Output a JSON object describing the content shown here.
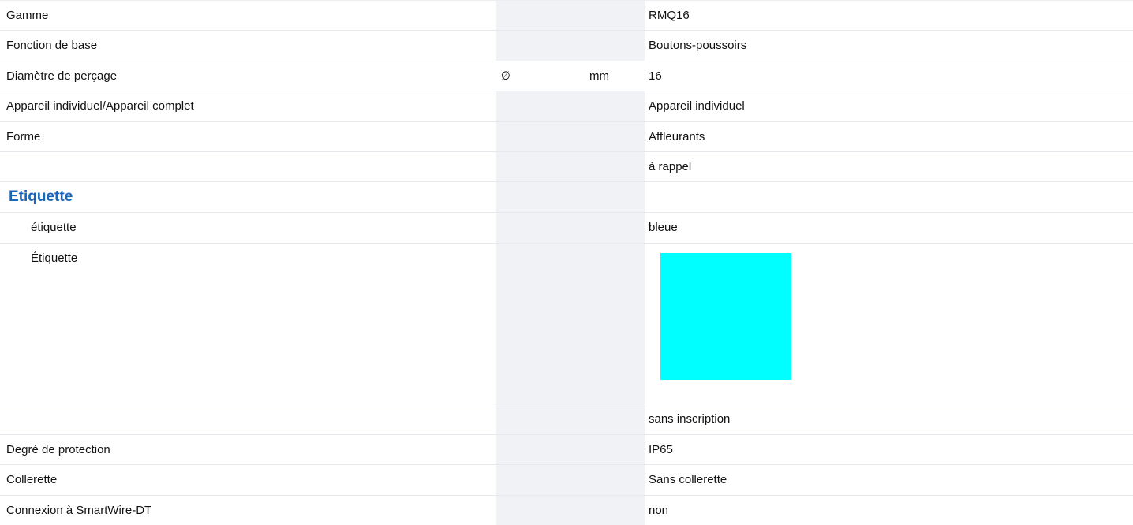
{
  "rows": [
    {
      "label": "Gamme",
      "symbol": "",
      "unit": "",
      "value": "RMQ16"
    },
    {
      "label": "Fonction de base",
      "symbol": "",
      "unit": "",
      "value": "Boutons-poussoirs"
    },
    {
      "label": "Diamètre de perçage",
      "symbol": "∅",
      "unit": "mm",
      "value": "16"
    },
    {
      "label": "Appareil individuel/Appareil complet",
      "symbol": "",
      "unit": "",
      "value": "Appareil individuel"
    },
    {
      "label": "Forme",
      "symbol": "",
      "unit": "",
      "value": "Affleurants"
    },
    {
      "label": "",
      "symbol": "",
      "unit": "",
      "value": "à rappel"
    }
  ],
  "group": {
    "title": "Etiquette",
    "rows": [
      {
        "label": "étiquette",
        "value": "bleue"
      },
      {
        "label": "Étiquette",
        "swatch_color": "#00ffff"
      },
      {
        "label": "",
        "value": "sans inscription"
      }
    ]
  },
  "rows_after": [
    {
      "label": "Degré de protection",
      "value": "IP65"
    },
    {
      "label": "Collerette",
      "value": "Sans collerette"
    },
    {
      "label": "Connexion à SmartWire-DT",
      "value": "non"
    }
  ]
}
